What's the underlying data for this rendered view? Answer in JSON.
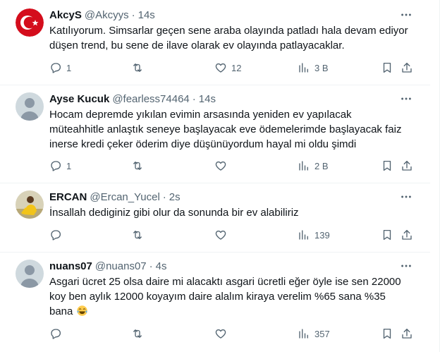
{
  "tweets": [
    {
      "name": "AkcyS",
      "handle": "@Akcyys",
      "dot": "·",
      "time": "14s",
      "text_lines": [
        "Katılıyorum. Simsarlar geçen sene araba olayında patladı hala devam ediyor",
        "düşen trend, bu sene de ilave olarak ev olayında patlayacaklar."
      ],
      "replies": "1",
      "retweets": "",
      "likes": "12",
      "views": "3 B"
    },
    {
      "name": "Ayse Kucuk",
      "handle": "@fearless74464",
      "dot": "·",
      "time": "14s",
      "text_lines": [
        "Hocam depremde yıkılan evimin arsasında yeniden ev yapılacak",
        "müteahhitle anlaştık seneye başlayacak eve ödemelerimde başlayacak faiz",
        "inerse kredi çeker öderim diye düşünüyordum hayal mi oldu şimdi"
      ],
      "replies": "1",
      "retweets": "",
      "likes": "",
      "views": "2 B"
    },
    {
      "name": "ERCAN",
      "handle": "@Ercan_Yucel",
      "dot": "·",
      "time": "2s",
      "text_lines": [
        "İnsallah dediginiz gibi olur da sonunda bir ev alabiliriz"
      ],
      "replies": "",
      "retweets": "",
      "likes": "",
      "views": "139"
    },
    {
      "name": "nuans07",
      "handle": "@nuans07",
      "dot": "·",
      "time": "4s",
      "text_lines": [
        "Asgari ücret 25 olsa daire mi alacaktı asgari ücretli eğer öyle ise sen 22000",
        "koy ben aylık 12000 koyayım daire alalım kiraya verelim %65 sana %35",
        "bana"
      ],
      "emoji": "face-with-tears-of-joy",
      "replies": "",
      "retweets": "",
      "likes": "",
      "views": "357"
    }
  ],
  "icons": {
    "reply": "reply-icon",
    "retweet": "retweet-icon",
    "like": "heart-icon",
    "views": "views-chart-icon",
    "bookmark": "bookmark-icon",
    "share": "share-icon",
    "more": "more-dots-icon"
  },
  "colors": {
    "text": "#0f1419",
    "secondary": "#536471",
    "border": "#eff3f4"
  }
}
